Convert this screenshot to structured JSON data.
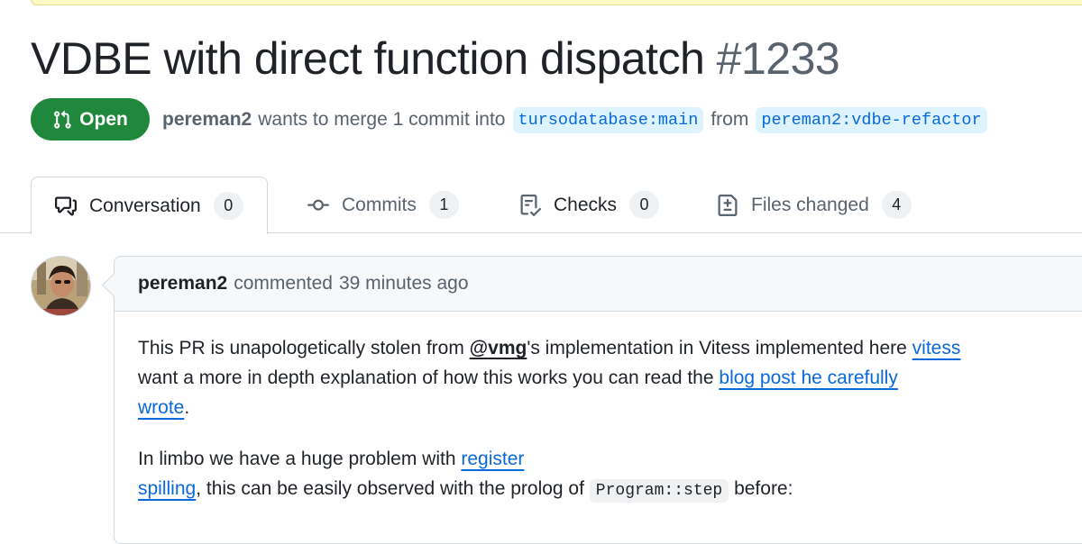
{
  "pr": {
    "title": "VDBE with direct function dispatch",
    "number": "#1233",
    "state": "Open",
    "author": "pereman2",
    "merge_text": "wants to merge 1 commit into",
    "base_branch": "tursodatabase:main",
    "from_text": "from",
    "head_branch": "pereman2:vdbe-refactor"
  },
  "tabs": [
    {
      "label": "Conversation",
      "count": "0",
      "icon": "comment-discussion-icon"
    },
    {
      "label": "Commits",
      "count": "1",
      "icon": "git-commit-icon"
    },
    {
      "label": "Checks",
      "count": "0",
      "icon": "checklist-icon"
    },
    {
      "label": "Files changed",
      "count": "4",
      "icon": "file-diff-icon"
    }
  ],
  "comment": {
    "author": "pereman2",
    "action": "commented",
    "time": "39 minutes ago",
    "p1": {
      "t1": "This PR is unapologetically stolen from ",
      "mention": "@vmg",
      "t2": "'s implementation in Vitess implemented here ",
      "link1": "vitess",
      "t3": "want a more in depth explanation of how this works you can read the ",
      "link2a": "blog post he carefully",
      "link2b": "wrote",
      "t4": "."
    },
    "p2": {
      "t1": "In limbo we have a huge problem with ",
      "link_a": "register",
      "link_b": "spilling",
      "t2": ", this can be easily observed with the prolog of ",
      "code": "Program::step",
      "t3": " before:"
    }
  },
  "colors": {
    "open_green": "#1f883d",
    "link_blue": "#0969da",
    "branch_bg": "#ddf4ff",
    "muted": "#59636e"
  }
}
